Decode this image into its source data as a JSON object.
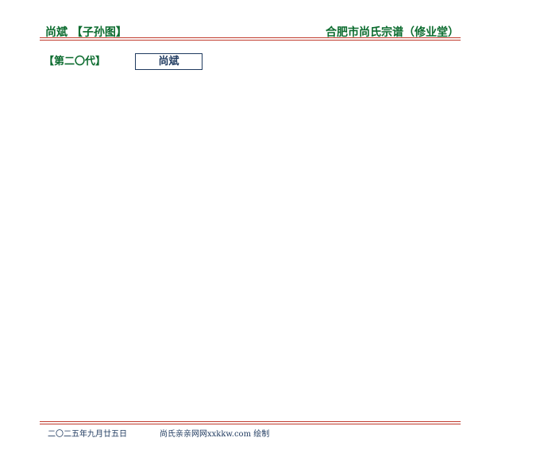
{
  "header": {
    "left_title": "尚斌  【子孙图】",
    "right_title": "合肥市尚氏宗谱（修业堂）"
  },
  "generation": {
    "label": "【第二〇代】"
  },
  "person": {
    "name": "尚斌"
  },
  "footer": {
    "date": "二〇二五年九月廿五日",
    "site": "尚氏亲亲网网xxkkw.com 绘制"
  },
  "colors": {
    "title_green": "#0b6b2e",
    "rule_red": "#c0392b",
    "text_navy": "#1f3a5f"
  }
}
